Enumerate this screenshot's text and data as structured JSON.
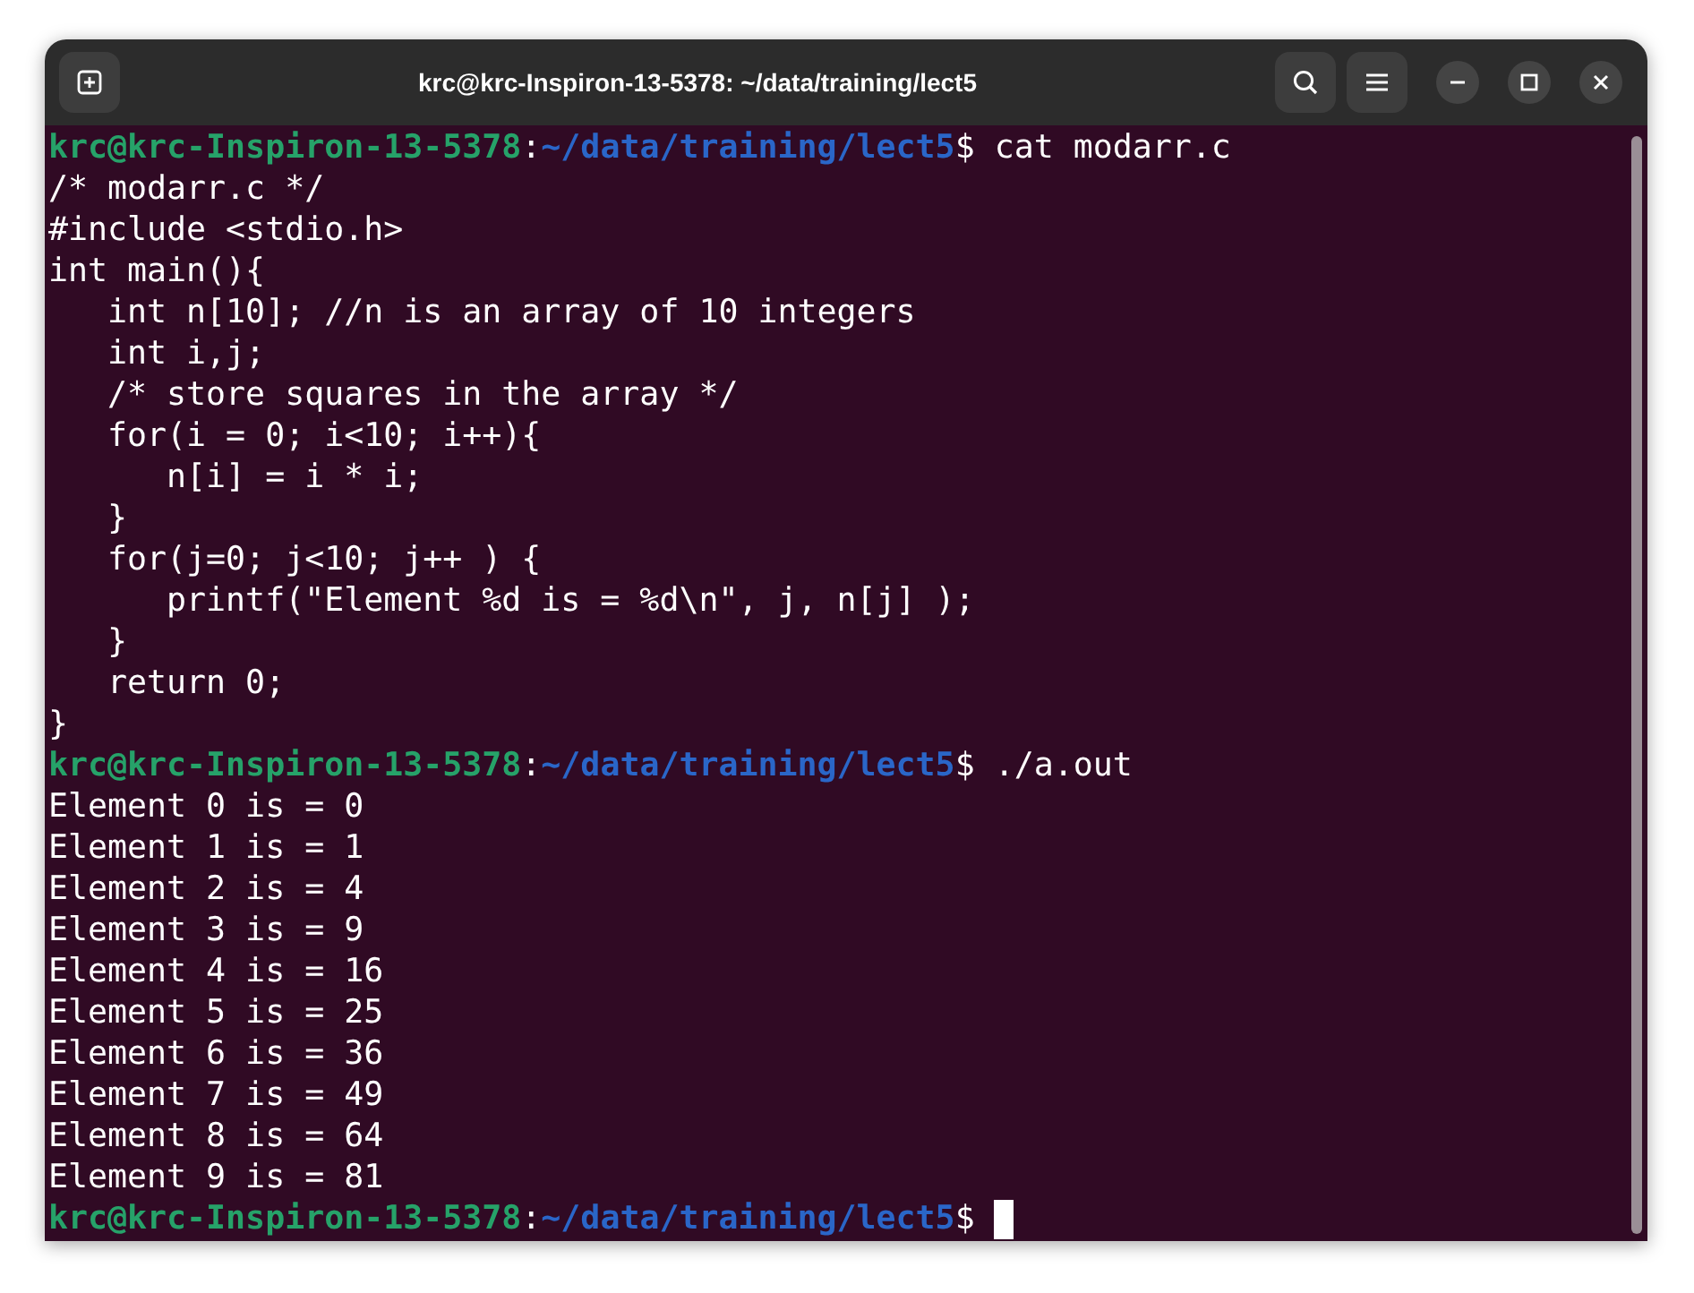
{
  "window": {
    "title": "krc@krc-Inspiron-13-5378: ~/data/training/lect5"
  },
  "terminal": {
    "lines": [
      {
        "kind": "prompt",
        "user_host": "krc@krc-Inspiron-13-5378",
        "separator": ":",
        "path": "~/data/training/lect5",
        "symbol": "$",
        "command": "cat modarr.c",
        "cursor": false
      },
      {
        "kind": "output",
        "text": "/* modarr.c */"
      },
      {
        "kind": "output",
        "text": "#include <stdio.h>"
      },
      {
        "kind": "output",
        "text": "int main(){"
      },
      {
        "kind": "output",
        "text": "   int n[10]; //n is an array of 10 integers"
      },
      {
        "kind": "output",
        "text": "   int i,j;"
      },
      {
        "kind": "output",
        "text": "   /* store squares in the array */"
      },
      {
        "kind": "output",
        "text": "   for(i = 0; i<10; i++){"
      },
      {
        "kind": "output",
        "text": "      n[i] = i * i;"
      },
      {
        "kind": "output",
        "text": "   }"
      },
      {
        "kind": "output",
        "text": "   for(j=0; j<10; j++ ) {"
      },
      {
        "kind": "output",
        "text": "      printf(\"Element %d is = %d\\n\", j, n[j] );"
      },
      {
        "kind": "output",
        "text": "   }"
      },
      {
        "kind": "output",
        "text": "   return 0;"
      },
      {
        "kind": "output",
        "text": "}"
      },
      {
        "kind": "prompt",
        "user_host": "krc@krc-Inspiron-13-5378",
        "separator": ":",
        "path": "~/data/training/lect5",
        "symbol": "$",
        "command": "./a.out",
        "cursor": false
      },
      {
        "kind": "output",
        "text": "Element 0 is = 0"
      },
      {
        "kind": "output",
        "text": "Element 1 is = 1"
      },
      {
        "kind": "output",
        "text": "Element 2 is = 4"
      },
      {
        "kind": "output",
        "text": "Element 3 is = 9"
      },
      {
        "kind": "output",
        "text": "Element 4 is = 16"
      },
      {
        "kind": "output",
        "text": "Element 5 is = 25"
      },
      {
        "kind": "output",
        "text": "Element 6 is = 36"
      },
      {
        "kind": "output",
        "text": "Element 7 is = 49"
      },
      {
        "kind": "output",
        "text": "Element 8 is = 64"
      },
      {
        "kind": "output",
        "text": "Element 9 is = 81"
      },
      {
        "kind": "prompt",
        "user_host": "krc@krc-Inspiron-13-5378",
        "separator": ":",
        "path": "~/data/training/lect5",
        "symbol": "$",
        "cursor": true
      }
    ]
  }
}
